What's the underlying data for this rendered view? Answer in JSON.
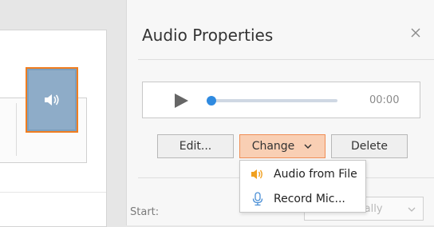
{
  "panel": {
    "title": "Audio Properties",
    "close_icon": "close-icon"
  },
  "player": {
    "play_icon": "play-icon",
    "time": "00:00",
    "progress_fraction": 0.0
  },
  "buttons": {
    "edit": "Edit...",
    "change": "Change",
    "delete": "Delete"
  },
  "change_menu": {
    "items": [
      {
        "label": "Audio from File",
        "icon": "speaker-icon"
      },
      {
        "label": "Record Mic...",
        "icon": "microphone-icon"
      }
    ]
  },
  "start": {
    "label": "Start:",
    "value": "Automatically"
  },
  "colors": {
    "accent_orange": "#f07d1f",
    "change_button_bg": "#f9cfb4",
    "slider_blue": "#2f8ae0",
    "audio_object_bg": "#8eacc8"
  }
}
